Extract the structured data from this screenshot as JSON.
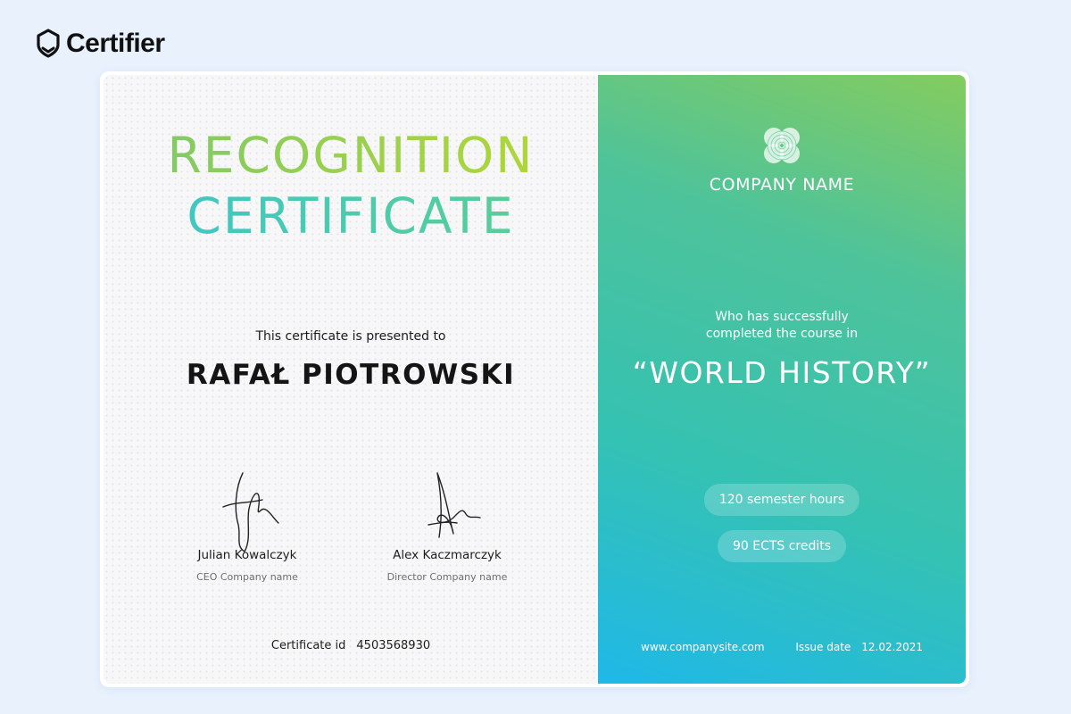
{
  "brand": {
    "name": "Certifier"
  },
  "certificate": {
    "title_line1": "RECOGNITION",
    "title_line2": "CERTIFICATE",
    "presented_text": "This certificate is presented to",
    "recipient": "RAFAŁ PIOTROWSKI",
    "signatories": [
      {
        "name": "Julian Kowalczyk",
        "role": "CEO Company name"
      },
      {
        "name": "Alex Kaczmarczyk",
        "role": "Director Company name"
      }
    ],
    "id_label": "Certificate id",
    "id_value": "4503568930"
  },
  "right_panel": {
    "company_name": "COMPANY NAME",
    "completion_text_line1": "Who has successfully",
    "completion_text_line2": "completed the course in",
    "course_name": "“WORLD HISTORY”",
    "badges": [
      "120 semester hours",
      "90 ECTS credits"
    ],
    "website": "www.companysite.com",
    "issue_label": "Issue date",
    "issue_date": "12.02.2021"
  },
  "colors": {
    "page_bg": "#e8f1fc",
    "gradient_top": "#84cc5f",
    "gradient_bottom": "#1fb8e8",
    "title_green": "#8fce4a",
    "title_teal": "#3ec6c4"
  },
  "icons": {
    "brand_logo": "certifier-shield-icon",
    "company_logo": "clover-fingerprint-icon"
  }
}
